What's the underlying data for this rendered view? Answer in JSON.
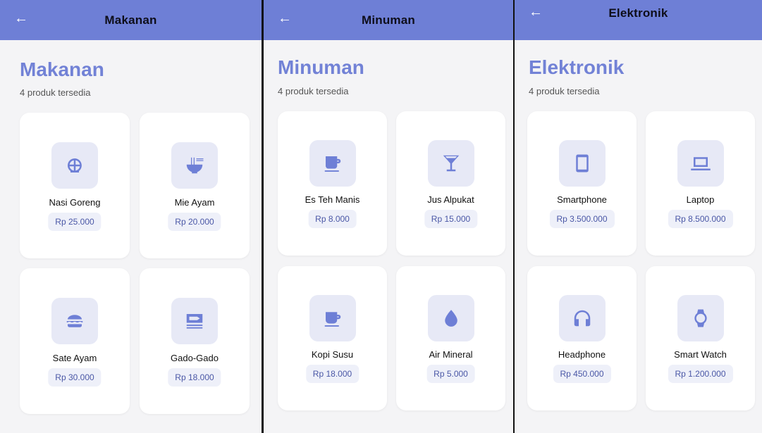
{
  "accent": "#6e7fd6",
  "screens": [
    {
      "title": "Makanan",
      "heading": "Makanan",
      "subtitle": "4 produk tersedia",
      "products": [
        {
          "name": "Nasi Goreng",
          "price": "Rp 25.000",
          "icon": "rice-bowl-icon"
        },
        {
          "name": "Mie Ayam",
          "price": "Rp 20.000",
          "icon": "noodle-bowl-icon"
        },
        {
          "name": "Sate Ayam",
          "price": "Rp 30.000",
          "icon": "burger-icon"
        },
        {
          "name": "Gado-Gado",
          "price": "Rp 18.000",
          "icon": "fish-plate-icon"
        }
      ]
    },
    {
      "title": "Minuman",
      "heading": "Minuman",
      "subtitle": "4 produk tersedia",
      "products": [
        {
          "name": "Es Teh Manis",
          "price": "Rp 8.000",
          "icon": "cup-icon"
        },
        {
          "name": "Jus Alpukat",
          "price": "Rp 15.000",
          "icon": "cocktail-glass-icon"
        },
        {
          "name": "Kopi Susu",
          "price": "Rp 18.000",
          "icon": "coffee-cup-icon"
        },
        {
          "name": "Air Mineral",
          "price": "Rp 5.000",
          "icon": "water-drop-icon"
        }
      ]
    },
    {
      "title": "Elektronik",
      "heading": "Elektronik",
      "subtitle": "4 produk tersedia",
      "products": [
        {
          "name": "Smartphone",
          "price": "Rp 3.500.000",
          "icon": "smartphone-icon"
        },
        {
          "name": "Laptop",
          "price": "Rp 8.500.000",
          "icon": "laptop-icon"
        },
        {
          "name": "Headphone",
          "price": "Rp 450.000",
          "icon": "headphones-icon"
        },
        {
          "name": "Smart Watch",
          "price": "Rp 1.200.000",
          "icon": "watch-icon"
        }
      ]
    }
  ]
}
